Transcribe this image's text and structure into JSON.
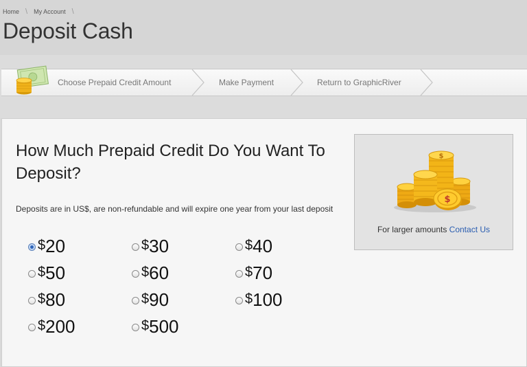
{
  "breadcrumb": [
    {
      "label": "Home"
    },
    {
      "label": "My Account"
    }
  ],
  "page_title": "Deposit Cash",
  "steps": [
    {
      "label": "Choose Prepaid Credit Amount",
      "icon": "cash-coins-icon"
    },
    {
      "label": "Make Payment"
    },
    {
      "label": "Return to GraphicRiver"
    }
  ],
  "main": {
    "question": "How Much Prepaid Credit Do You Want To Deposit?",
    "note": "Deposits are in US$, are non-refundable and will expire one year from your last deposit",
    "currency_symbol": "$",
    "options": [
      {
        "amount": "20",
        "selected": true
      },
      {
        "amount": "30",
        "selected": false
      },
      {
        "amount": "40",
        "selected": false
      },
      {
        "amount": "50",
        "selected": false
      },
      {
        "amount": "60",
        "selected": false
      },
      {
        "amount": "70",
        "selected": false
      },
      {
        "amount": "80",
        "selected": false
      },
      {
        "amount": "90",
        "selected": false
      },
      {
        "amount": "100",
        "selected": false
      },
      {
        "amount": "200",
        "selected": false
      },
      {
        "amount": "500",
        "selected": false
      }
    ]
  },
  "sidebox": {
    "text": "For larger amounts",
    "link": "Contact Us",
    "image": "gold-coin-stacks-icon"
  },
  "colors": {
    "link": "#2a5db0",
    "coin_gold": "#f2b417"
  }
}
